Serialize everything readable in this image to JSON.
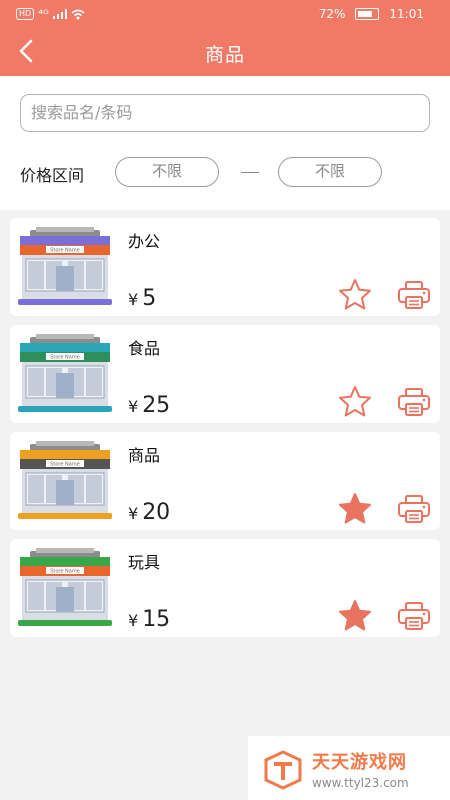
{
  "status": {
    "net": "HD",
    "signal": "⁴ᴳ",
    "battery": "72%",
    "time": "11:01"
  },
  "header": {
    "title": "商品"
  },
  "search": {
    "placeholder": "搜索品名/条码"
  },
  "price_filter": {
    "label": "价格区间",
    "min": "不限",
    "max": "不限",
    "separator": "—"
  },
  "products": [
    {
      "name": "办公",
      "currency": "¥",
      "price": "5",
      "favorited": false,
      "store_sign": "Store Name",
      "stripe": "#e8662e",
      "roof": "#7a6fd6"
    },
    {
      "name": "食品",
      "currency": "¥",
      "price": "25",
      "favorited": false,
      "store_sign": "Store Name",
      "stripe": "#2e8f5a",
      "roof": "#2aa6b8"
    },
    {
      "name": "商品",
      "currency": "¥",
      "price": "20",
      "favorited": true,
      "store_sign": "Store Name",
      "stripe": "#555555",
      "roof": "#f0a020"
    },
    {
      "name": "玩具",
      "currency": "¥",
      "price": "15",
      "favorited": true,
      "store_sign": "Store Name",
      "stripe": "#e8662e",
      "roof": "#3aa64a"
    }
  ],
  "colors": {
    "accent": "#f07a66",
    "icon": "#e8745f"
  },
  "watermark": {
    "title": "天天游戏网",
    "url": "www.ttyl23.com"
  }
}
